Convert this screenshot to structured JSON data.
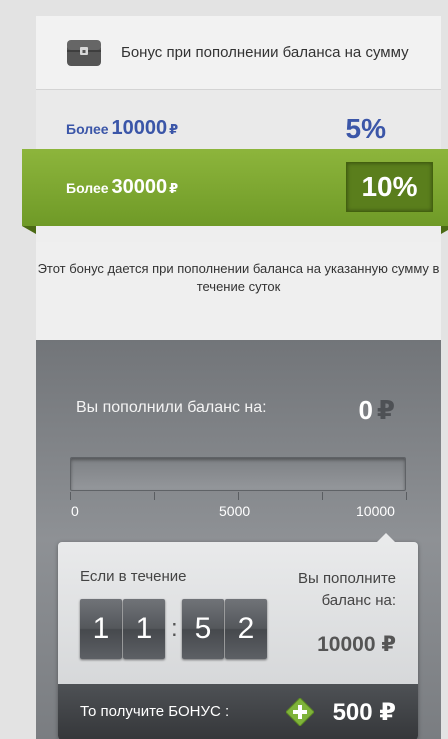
{
  "header": {
    "title": "Бонус при пополнении баланса на сумму",
    "icon": "chest-icon"
  },
  "tiers": [
    {
      "prefix": "Более",
      "amount": "10000",
      "currency": "₽",
      "percent": "5%"
    },
    {
      "prefix": "Более",
      "amount": "30000",
      "currency": "₽",
      "percent": "10%",
      "active": true
    }
  ],
  "note": "Этот бонус дается при пополнении баланса на указанную сумму в течение суток",
  "topup": {
    "label": "Вы пополнили баланс на:",
    "value": "0",
    "currency": "₽",
    "progress": 0,
    "ticks": [
      "0",
      "5000",
      "10000"
    ]
  },
  "counter": {
    "if_label": "Если в течение",
    "digits": [
      "1",
      "1",
      "5",
      "2"
    ],
    "separator": ":",
    "right_label": "Вы пополните баланс на:",
    "amount": "10000",
    "currency": "₽"
  },
  "bonus": {
    "label": "То получите БОНУС :",
    "value": "500",
    "currency": "₽",
    "icon": "plus-icon"
  },
  "colors": {
    "accent_green": "#7aa62f",
    "accent_blue": "#3b56a8",
    "dark_panel": "#808386"
  }
}
